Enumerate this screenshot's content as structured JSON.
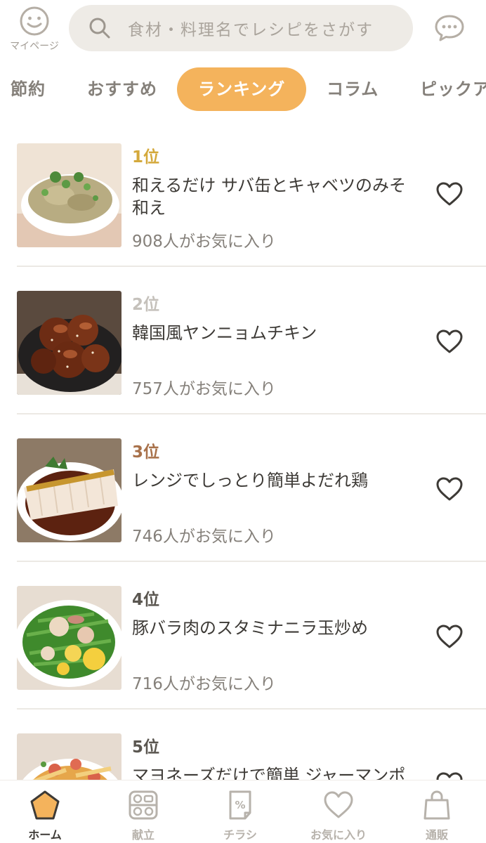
{
  "header": {
    "mypage_label": "マイページ",
    "search_placeholder": "食材・料理名でレシピをさがす"
  },
  "tabs": [
    {
      "label": "節約",
      "active": false
    },
    {
      "label": "おすすめ",
      "active": false
    },
    {
      "label": "ランキング",
      "active": true
    },
    {
      "label": "コラム",
      "active": false
    },
    {
      "label": "ピックアップ",
      "active": false
    }
  ],
  "ranking": [
    {
      "rank": "1位",
      "rank_color": "#d4a93c",
      "title": "和えるだけ サバ缶とキャベツのみそ和え",
      "favorites": "908人がお気に入り",
      "image": "saba-cabbage"
    },
    {
      "rank": "2位",
      "rank_color": "#c5c1bb",
      "title": "韓国風ヤンニョムチキン",
      "favorites": "757人がお気に入り",
      "image": "yangnyeom-chicken"
    },
    {
      "rank": "3位",
      "rank_color": "#a8714a",
      "title": "レンジでしっとり簡単よだれ鶏",
      "favorites": "746人がお気に入り",
      "image": "yodare-dori"
    },
    {
      "rank": "4位",
      "rank_color": "#5a5650",
      "title": "豚バラ肉のスタミナニラ玉炒め",
      "favorites": "716人がお気に入り",
      "image": "nira-tama"
    },
    {
      "rank": "5位",
      "rank_color": "#5a5650",
      "title": "マヨネーズだけで簡単 ジャーマンポテト",
      "favorites": "",
      "image": "german-potato"
    }
  ],
  "bottom_nav": [
    {
      "label": "ホーム",
      "icon": "home-icon",
      "active": true
    },
    {
      "label": "献立",
      "icon": "menu-plan-icon",
      "active": false
    },
    {
      "label": "チラシ",
      "icon": "flyer-icon",
      "active": false
    },
    {
      "label": "お気に入り",
      "icon": "heart-icon",
      "active": false
    },
    {
      "label": "通販",
      "icon": "shopping-bag-icon",
      "active": false
    }
  ],
  "colors": {
    "accent": "#f4b35c",
    "text": "#3d3a36",
    "subtext": "#85807a",
    "search_bg": "#eeebe6"
  }
}
